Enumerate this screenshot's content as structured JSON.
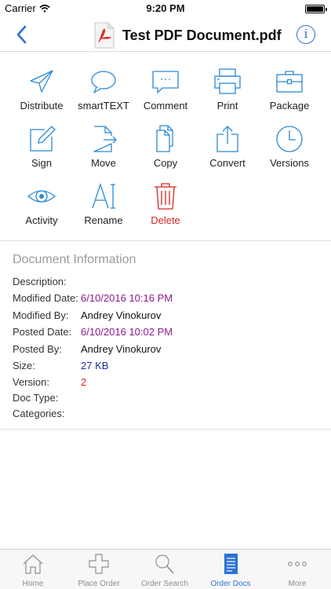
{
  "status_bar": {
    "carrier": "Carrier",
    "time": "9:20 PM"
  },
  "nav": {
    "title": "Test PDF Document.pdf",
    "info_glyph": "i"
  },
  "actions": [
    {
      "id": "distribute",
      "label": "Distribute",
      "icon": "paper-plane-icon"
    },
    {
      "id": "smarttext",
      "label": "smartTEXT",
      "icon": "speech-bubble-icon"
    },
    {
      "id": "comment",
      "label": "Comment",
      "icon": "comment-icon"
    },
    {
      "id": "print",
      "label": "Print",
      "icon": "printer-icon"
    },
    {
      "id": "package",
      "label": "Package",
      "icon": "briefcase-icon"
    },
    {
      "id": "sign",
      "label": "Sign",
      "icon": "pen-icon"
    },
    {
      "id": "move",
      "label": "Move",
      "icon": "move-document-icon"
    },
    {
      "id": "copy",
      "label": "Copy",
      "icon": "copy-icon"
    },
    {
      "id": "convert",
      "label": "Convert",
      "icon": "share-icon"
    },
    {
      "id": "versions",
      "label": "Versions",
      "icon": "clock-icon"
    },
    {
      "id": "activity",
      "label": "Activity",
      "icon": "eye-icon"
    },
    {
      "id": "rename",
      "label": "Rename",
      "icon": "text-cursor-icon"
    },
    {
      "id": "delete",
      "label": "Delete",
      "icon": "trash-icon"
    }
  ],
  "doc_info": {
    "title": "Document Information",
    "rows": [
      {
        "key": "Description:",
        "value": ""
      },
      {
        "key": "Modified Date:",
        "value": "6/10/2016 10:16 PM"
      },
      {
        "key": "Modified By:",
        "value": "Andrey Vinokurov"
      },
      {
        "key": "Posted Date:",
        "value": "6/10/2016 10:02 PM"
      },
      {
        "key": "Posted By:",
        "value": "Andrey Vinokurov"
      },
      {
        "key": "Size:",
        "value": "27 KB"
      },
      {
        "key": "Version:",
        "value": "2"
      },
      {
        "key": "Doc Type:",
        "value": ""
      },
      {
        "key": "Categories:",
        "value": ""
      }
    ]
  },
  "tabs": [
    {
      "label": "Home",
      "icon": "house-icon",
      "active": false
    },
    {
      "label": "Place Order",
      "icon": "plus-icon",
      "active": false
    },
    {
      "label": "Order Search",
      "icon": "search-icon",
      "active": false
    },
    {
      "label": "Order Docs",
      "icon": "document-list-icon",
      "active": true
    },
    {
      "label": "More",
      "icon": "ellipsis-icon",
      "active": false
    }
  ],
  "colors": {
    "accent": "#2a72d5",
    "date_value": "#8b1a8b",
    "size_value": "#1a2fa8",
    "version_value": "#d0281f",
    "delete": "#d0281f",
    "section_title": "#9a9a9a"
  }
}
